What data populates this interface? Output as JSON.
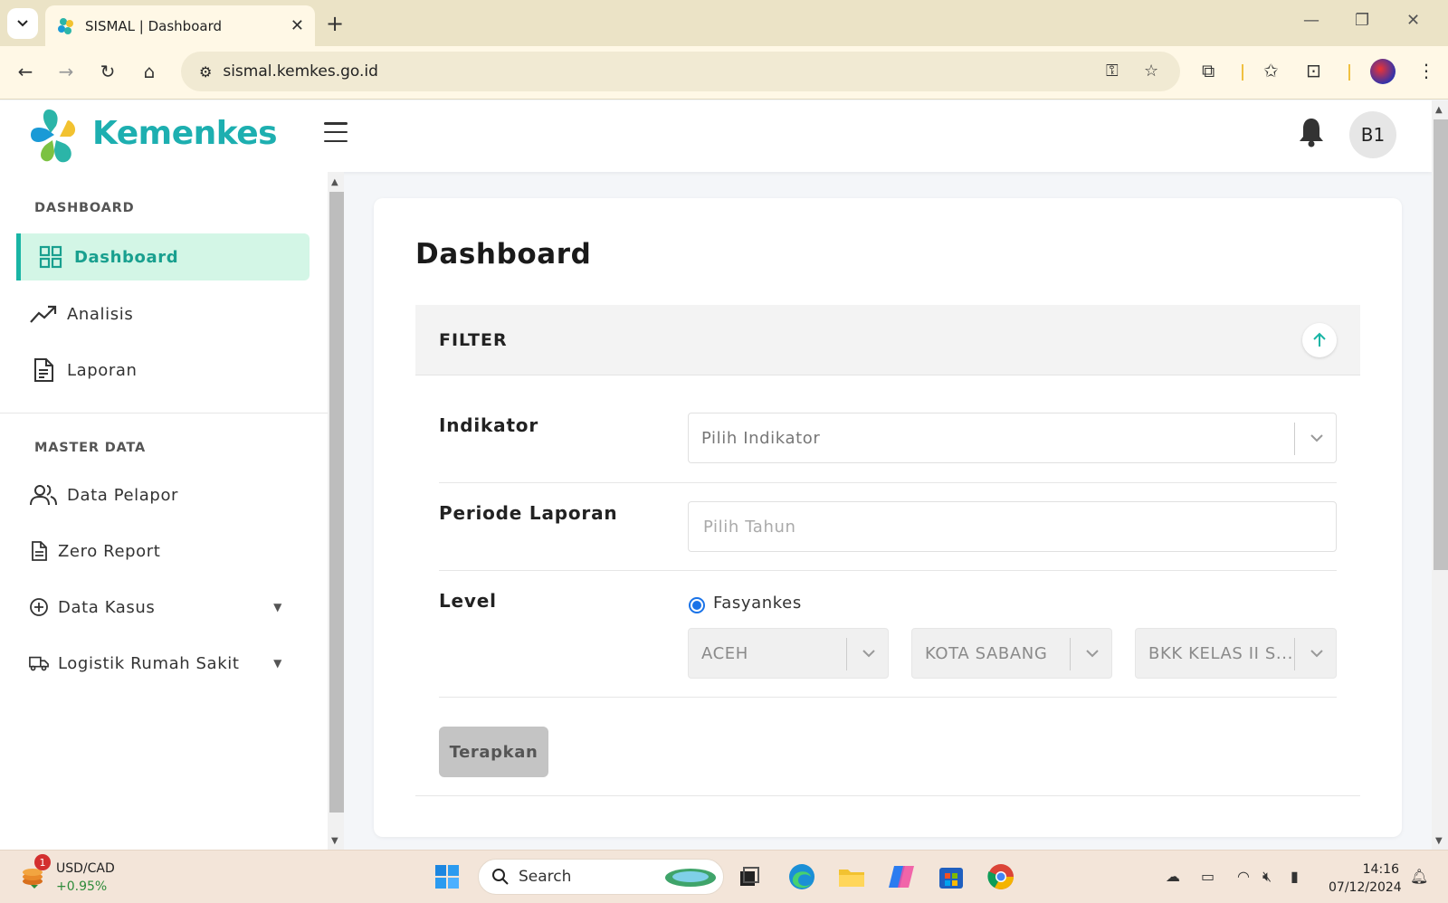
{
  "browser": {
    "tab_title": "SISMAL | Dashboard",
    "url": "sismal.kemkes.go.id"
  },
  "header": {
    "logo_text": "Kemenkes",
    "avatar_initials": "B1"
  },
  "sidebar": {
    "section_dashboard": "DASHBOARD",
    "section_master": "MASTER DATA",
    "items": [
      {
        "label": "Dashboard"
      },
      {
        "label": "Analisis"
      },
      {
        "label": "Laporan"
      },
      {
        "label": "Data Pelapor"
      },
      {
        "label": "Zero Report"
      },
      {
        "label": "Data Kasus"
      },
      {
        "label": "Logistik Rumah Sakit"
      }
    ]
  },
  "main": {
    "title": "Dashboard",
    "filter": {
      "header": "FILTER",
      "indikator_label": "Indikator",
      "indikator_placeholder": "Pilih Indikator",
      "periode_label": "Periode Laporan",
      "periode_placeholder": "Pilih Tahun",
      "level_label": "Level",
      "level_option": "Fasyankes",
      "province": "ACEH",
      "city": "KOTA SABANG",
      "facility": "BKK KELAS II S...",
      "apply_label": "Terapkan"
    }
  },
  "taskbar": {
    "fx_pair": "USD/CAD",
    "fx_change": "+0.95%",
    "fx_badge": "1",
    "search_label": "Search",
    "time": "14:16",
    "date": "07/12/2024"
  },
  "colors": {
    "accent": "#19b5a5",
    "active_bg": "#d3f6e6",
    "logo": "#1dafb0",
    "radio": "#1a73e8"
  }
}
